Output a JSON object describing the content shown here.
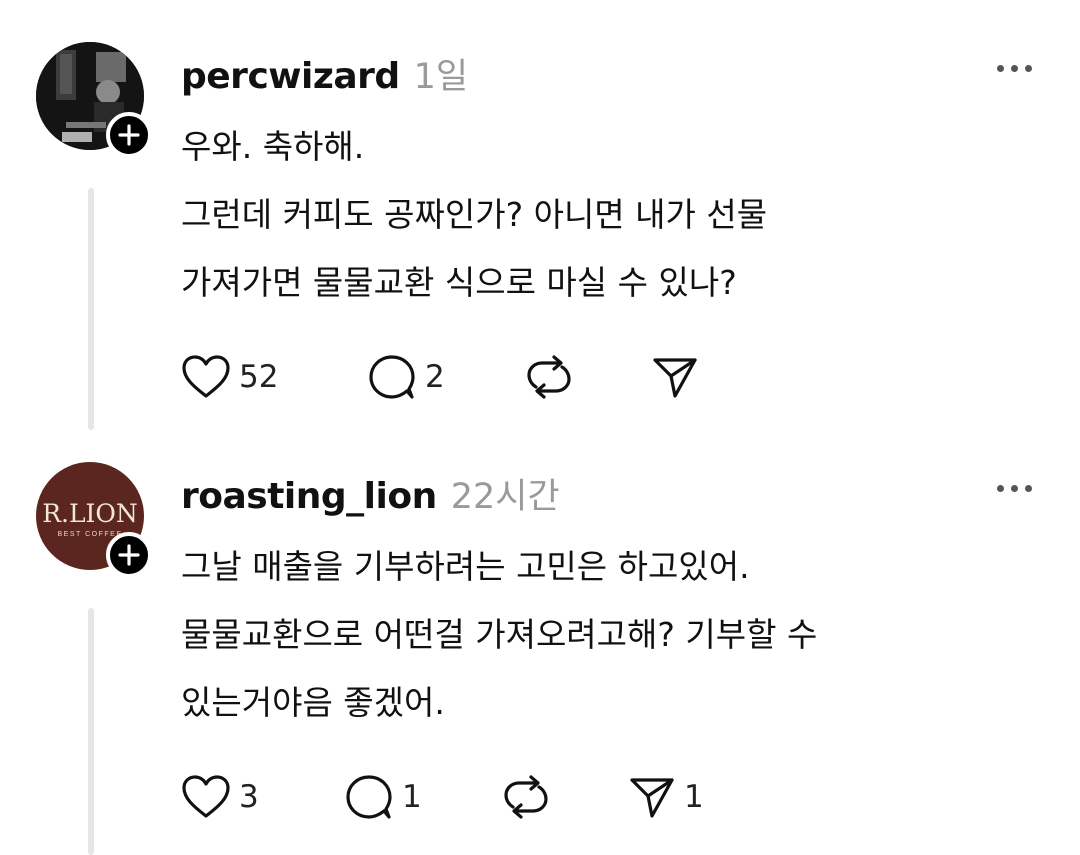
{
  "comments": [
    {
      "username": "percwizard",
      "time": "1일",
      "lines": [
        "우와. 축하해.",
        "그런데 커피도 공짜인가? 아니면 내가 선물",
        "가져가면 물물교환 식으로 마실 수 있나?"
      ],
      "likes": "52",
      "replies": "2",
      "reposts": "",
      "shares": ""
    },
    {
      "username": "roasting_lion",
      "time": "22시간",
      "avatar_logo": "R.LION",
      "avatar_logo_sub": "BEST COFFEE",
      "lines": [
        "그날 매출을 기부하려는 고민은 하고있어.",
        "물물교환으로 어떤걸 가져오려고해? 기부할 수",
        "있는거야음 좋겠어."
      ],
      "likes": "3",
      "replies": "1",
      "reposts": "",
      "shares": "1"
    }
  ],
  "icons": {
    "like": "heart-icon",
    "reply": "comment-bubble-icon",
    "repost": "repost-icon",
    "share": "send-icon",
    "more": "more-dots-icon",
    "follow": "plus-icon"
  }
}
